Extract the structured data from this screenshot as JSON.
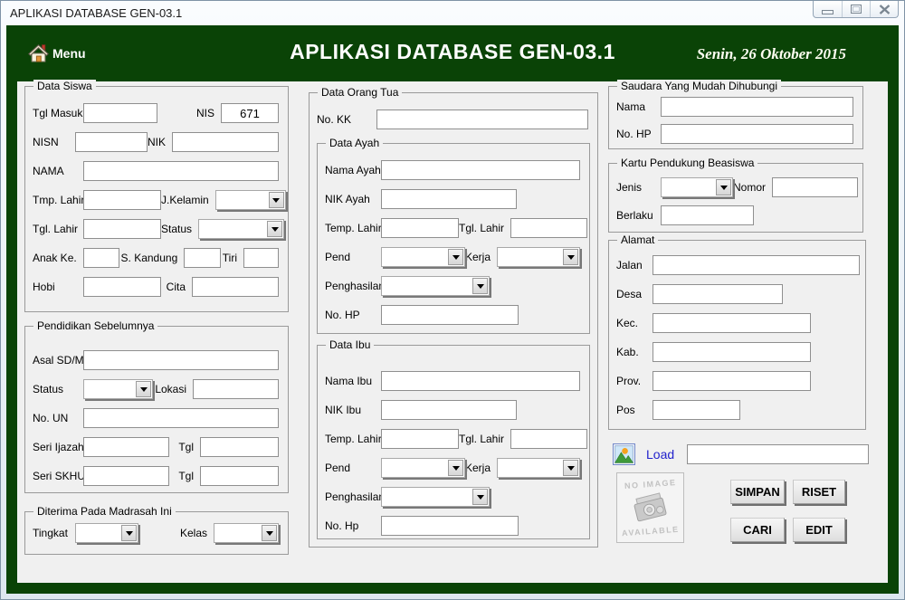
{
  "window": {
    "title": "APLIKASI DATABASE GEN-03.1"
  },
  "header": {
    "menu_label": "Menu",
    "title": "APLIKASI DATABASE GEN-03.1",
    "date": "Senin, 26 Oktober 2015"
  },
  "colors": {
    "header_green": "#0a4306",
    "content_bg": "#f0f0f0",
    "load_label_blue": "#2222cc"
  },
  "siswa": {
    "title": "Data Siswa",
    "labels": {
      "tgl_masuk": "Tgl Masuk",
      "nis": "NIS",
      "nisn": "NISN",
      "nik": "NIK",
      "nama": "NAMA",
      "tmp_lahir": "Tmp. Lahir",
      "j_kelamin": "J.Kelamin",
      "tgl_lahir": "Tgl. Lahir",
      "status": "Status",
      "anak_ke": "Anak Ke.",
      "s_kandung": "S. Kandung",
      "tiri": "Tiri",
      "hobi": "Hobi",
      "cita": "Cita"
    },
    "values": {
      "nis": "671"
    }
  },
  "pendidikan": {
    "title": "Pendidikan Sebelumnya",
    "labels": {
      "asal": "Asal SD/MI",
      "status": "Status",
      "lokasi": "Lokasi",
      "no_un": "No. UN",
      "seri_ijazah": "Seri Ijazah",
      "tgl_ijazah": "Tgl",
      "seri_skhu": "Seri SKHU",
      "tgl_skhu": "Tgl"
    }
  },
  "diterima": {
    "title": "Diterima Pada Madrasah Ini",
    "labels": {
      "tingkat": "Tingkat",
      "kelas": "Kelas"
    }
  },
  "orang_tua": {
    "title": "Data Orang Tua",
    "labels": {
      "no_kk": "No. KK"
    },
    "ayah": {
      "title": "Data Ayah",
      "labels": {
        "nama": "Nama Ayah",
        "nik": "NIK Ayah",
        "temp_lahir": "Temp. Lahir",
        "tgl_lahir": "Tgl. Lahir",
        "pend": "Pend",
        "kerja": "Kerja",
        "penghasilan": "Penghasilan",
        "no_hp": "No. HP"
      }
    },
    "ibu": {
      "title": "Data Ibu",
      "labels": {
        "nama": "Nama Ibu",
        "nik": "NIK Ibu",
        "temp_lahir": "Temp. Lahir",
        "tgl_lahir": "Tgl. Lahir",
        "pend": "Pend",
        "kerja": "Kerja",
        "penghasilan": "Penghasilan",
        "no_hp": "No. Hp"
      }
    }
  },
  "saudara": {
    "title": "Saudara Yang Mudah Dihubungi",
    "labels": {
      "nama": "Nama",
      "no_hp": "No. HP"
    }
  },
  "kartu": {
    "title": "Kartu Pendukung Beasiswa",
    "labels": {
      "jenis": "Jenis",
      "nomor": "Nomor",
      "berlaku": "Berlaku"
    }
  },
  "alamat": {
    "title": "Alamat",
    "labels": {
      "jalan": "Jalan",
      "desa": "Desa",
      "kec": "Kec.",
      "kab": "Kab.",
      "prov": "Prov.",
      "pos": "Pos"
    }
  },
  "photo": {
    "load_label": "Load",
    "no_image_top": "NO IMAGE",
    "no_image_bottom": "AVAILABLE"
  },
  "buttons": {
    "simpan": "SIMPAN",
    "riset": "RISET",
    "cari": "CARI",
    "edit": "EDIT"
  }
}
